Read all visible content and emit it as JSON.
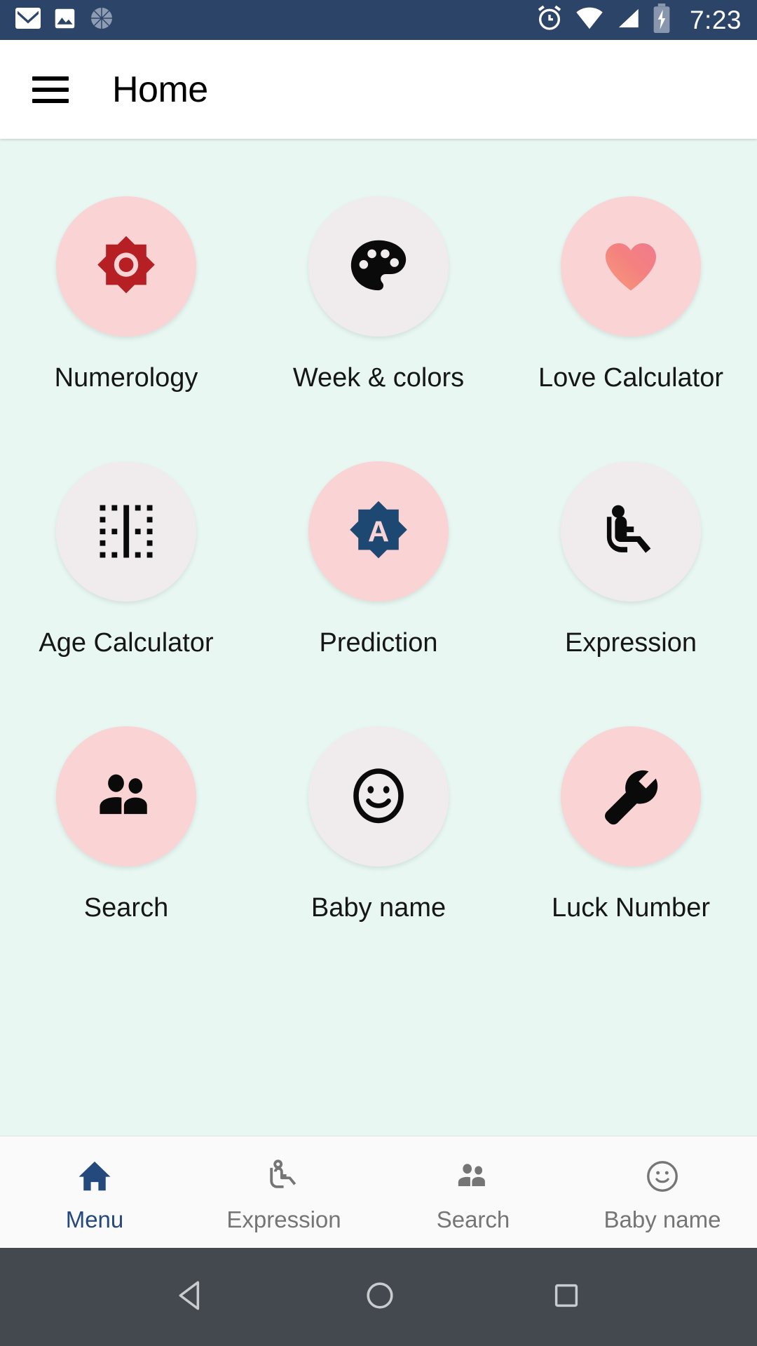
{
  "status_bar": {
    "icons_left": [
      "gmail-icon",
      "photos-icon",
      "sync-spinner-icon"
    ],
    "icons_right": [
      "alarm-icon",
      "wifi-icon",
      "signal-icon",
      "battery-charging-icon"
    ],
    "time": "7:23",
    "background_color": "#2b4468"
  },
  "app_bar": {
    "menu_icon": "hamburger-menu-icon",
    "title": "Home"
  },
  "main": {
    "background_color": "#e8f7f2",
    "rows": [
      [
        {
          "label": "Numerology",
          "icon": "numerology-star-icon",
          "bubble": "pink",
          "bubble_color": "#fad3d5"
        },
        {
          "label": "Week & colors",
          "icon": "palette-icon",
          "bubble": "gray",
          "bubble_color": "#f0ecee"
        },
        {
          "label": "Love Calculator",
          "icon": "heart-icon",
          "bubble": "pink",
          "bubble_color": "#fad3d5"
        }
      ],
      [
        {
          "label": "Age Calculator",
          "icon": "border-vertical-icon",
          "bubble": "gray",
          "bubble_color": "#f0ecee"
        },
        {
          "label": "Prediction",
          "icon": "letter-a-star-icon",
          "bubble": "pink",
          "bubble_color": "#fad3d5"
        },
        {
          "label": "Expression",
          "icon": "airline-seat-icon",
          "bubble": "gray",
          "bubble_color": "#f0ecee"
        }
      ],
      [
        {
          "label": "Search",
          "icon": "people-icon",
          "bubble": "pink",
          "bubble_color": "#fad3d5"
        },
        {
          "label": "Baby name",
          "icon": "smiley-face-icon",
          "bubble": "gray",
          "bubble_color": "#f0ecee"
        },
        {
          "label": "Luck Number",
          "icon": "wrench-icon",
          "bubble": "pink",
          "bubble_color": "#fad3d5"
        }
      ]
    ]
  },
  "bottom_nav": {
    "active_color": "#24497c",
    "inactive_color": "#757575",
    "items": [
      {
        "label": "Menu",
        "icon": "home-icon",
        "active": true
      },
      {
        "label": "Expression",
        "icon": "airline-seat-icon",
        "active": false
      },
      {
        "label": "Search",
        "icon": "people-icon",
        "active": false
      },
      {
        "label": "Baby name",
        "icon": "smiley-face-icon",
        "active": false
      }
    ]
  },
  "system_nav": {
    "background_color": "#43494f",
    "buttons": [
      "back-icon",
      "home-circle-icon",
      "recents-square-icon"
    ]
  }
}
